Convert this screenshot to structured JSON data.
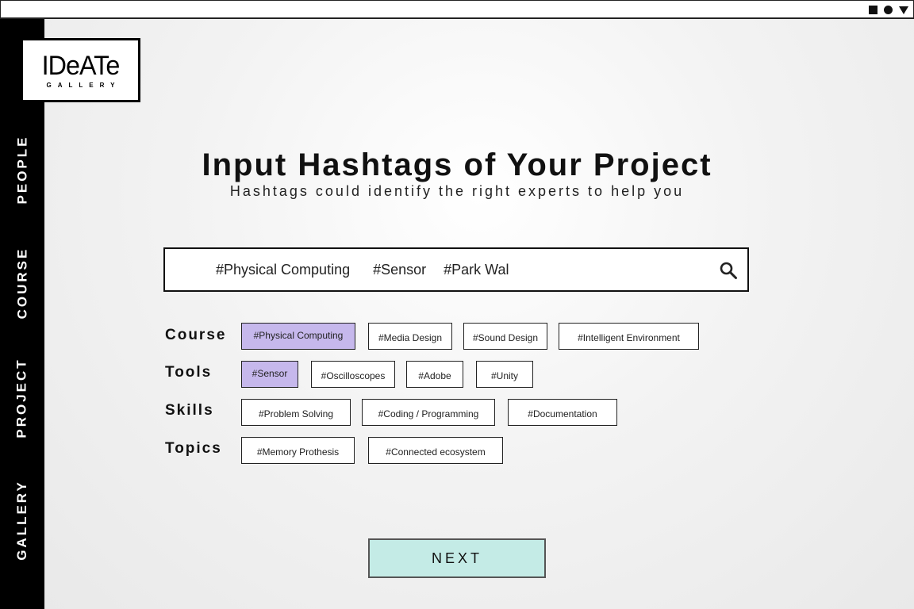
{
  "window": {
    "controls": [
      "square-icon",
      "circle-icon",
      "triangle-down-icon"
    ]
  },
  "logo": {
    "main": "IDeATe",
    "sub": "GALLERY"
  },
  "nav": {
    "people": "PEOPLE",
    "course": "COURSE",
    "project": "PROJECT",
    "gallery": "GALLERY"
  },
  "header": {
    "title": "Input Hashtags of Your Project",
    "subtitle": "Hashtags could identify the right experts to help you"
  },
  "search": {
    "tags": [
      "#Physical Computing",
      "#Sensor",
      "#Park Wal"
    ],
    "icon": "search-icon"
  },
  "categories": {
    "course": {
      "label": "Course",
      "tags": [
        "#Physical Computing",
        "#Media Design",
        "#Sound Design",
        "#Intelligent Environment"
      ]
    },
    "tools": {
      "label": "Tools",
      "tags": [
        "#Sensor",
        "#Oscilloscopes",
        "#Adobe",
        "#Unity"
      ]
    },
    "skills": {
      "label": "Skills",
      "tags": [
        "#Problem Solving",
        "#Coding / Programming",
        "#Documentation"
      ]
    },
    "topics": {
      "label": "Topics",
      "tags": [
        "#Memory Prothesis",
        "#Connected ecosystem"
      ]
    }
  },
  "selected_tags": [
    "#Physical Computing",
    "#Sensor"
  ],
  "colors": {
    "selected_tag": "#c6b8ec",
    "next_button": "#c4ebe6",
    "sidebar": "#000000"
  },
  "next_button": "NEXT"
}
